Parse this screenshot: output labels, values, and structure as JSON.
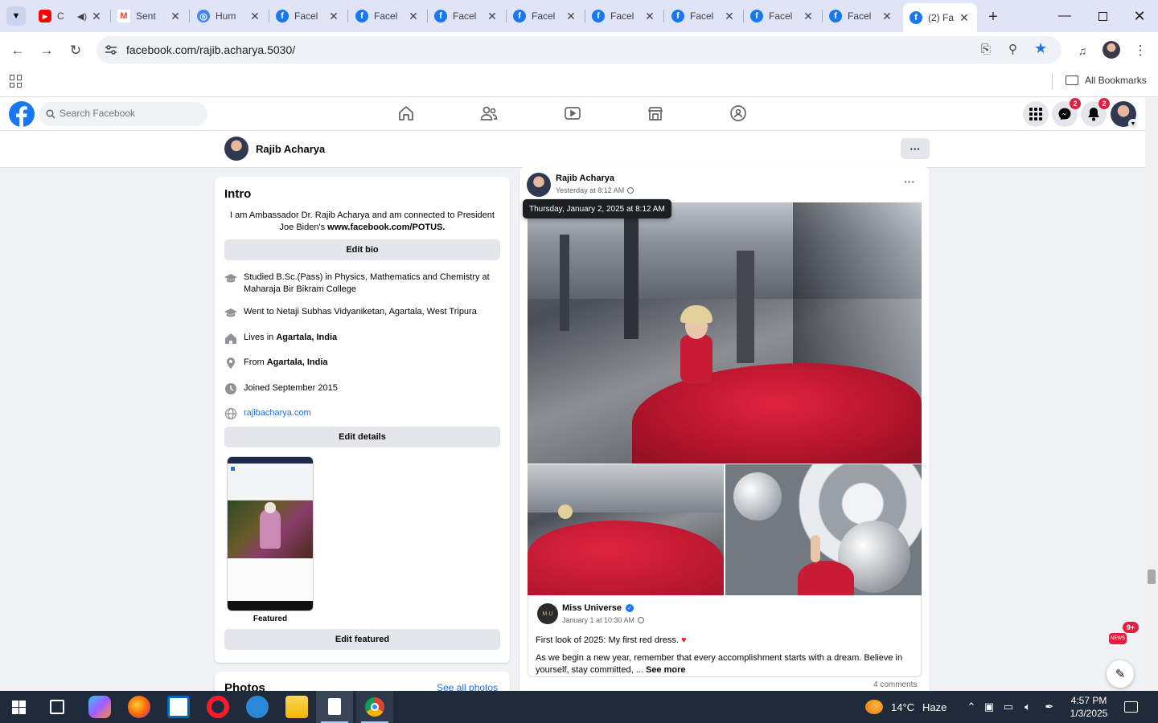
{
  "browser": {
    "tabs": [
      {
        "title": "C",
        "favicon": "youtube-icon",
        "color": "#ff0000"
      },
      {
        "title": "Sent",
        "favicon": "gmail-icon",
        "color": "#ea4335"
      },
      {
        "title": "Hum",
        "favicon": "globe-icon",
        "color": "#4285f4"
      },
      {
        "title": "Facel",
        "favicon": "facebook-icon",
        "color": "#1877f2"
      },
      {
        "title": "Facel",
        "favicon": "facebook-icon",
        "color": "#1877f2"
      },
      {
        "title": "Facel",
        "favicon": "facebook-icon",
        "color": "#1877f2"
      },
      {
        "title": "Facel",
        "favicon": "facebook-icon",
        "color": "#1877f2"
      },
      {
        "title": "Facel",
        "favicon": "facebook-icon",
        "color": "#1877f2"
      },
      {
        "title": "Facel",
        "favicon": "facebook-icon",
        "color": "#1877f2"
      },
      {
        "title": "Facel",
        "favicon": "facebook-icon",
        "color": "#1877f2"
      },
      {
        "title": "Facel",
        "favicon": "facebook-icon",
        "color": "#1877f2"
      },
      {
        "title": "(2) Fa",
        "favicon": "facebook-icon",
        "color": "#1877f2"
      }
    ],
    "url": "facebook.com/rajib.acharya.5030/",
    "all_bookmarks": "All Bookmarks"
  },
  "fb": {
    "search_placeholder": "Search Facebook",
    "messenger_badge": "2",
    "notif_badge": "2",
    "accent": "#1877f2"
  },
  "profile": {
    "name": "Rajib Acharya",
    "more": "···"
  },
  "intro": {
    "title": "Intro",
    "bio_pre": "I am Ambassador Dr. Rajib Acharya and am connected to President Joe Biden's ",
    "bio_link": "www.facebook.com/POTUS.",
    "edit_bio": "Edit bio",
    "studied": "Studied B.Sc.(Pass) in Physics, Mathematics and Chemistry at Maharaja Bir Bikram College",
    "went_to": "Went to Netaji Subhas Vidyaniketan, Agartala, West Tripura",
    "lives_pre": "Lives in ",
    "lives": "Agartala, India",
    "from_pre": "From ",
    "from": "Agartala, India",
    "joined": "Joined September 2015",
    "website": "rajibacharya.com",
    "edit_details": "Edit details",
    "featured": "Featured",
    "edit_featured": "Edit featured"
  },
  "photos": {
    "title": "Photos",
    "see_all": "See all photos"
  },
  "post": {
    "author": "Rajib Acharya",
    "time": "Yesterday at 8:12 AM",
    "tooltip": "Thursday, January 2, 2025 at 8:12 AM",
    "shared_author": "Miss Universe",
    "shared_time": "January 1 at 10:30 AM",
    "shared_line1": "First look of 2025: My first red dress. ",
    "shared_line2": "As we begin a new year, remember that every accomplishment starts with a dream. Believe in yourself, stay committed, ... ",
    "see_more": "See more",
    "comments": "4 comments"
  },
  "taskbar": {
    "weather_temp": "14°C",
    "weather_desc": "Haze",
    "time": "4:57 PM",
    "date": "1/3/2025",
    "news_badge": "9+"
  }
}
